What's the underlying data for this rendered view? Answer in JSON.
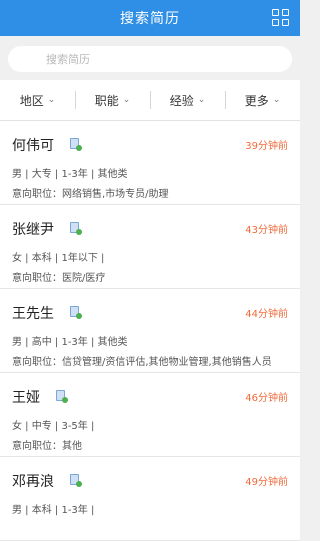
{
  "header": {
    "title": "搜索简历",
    "menu_icon": "grid-icon"
  },
  "search": {
    "placeholder": "搜索简历"
  },
  "filters": [
    {
      "label": "地区"
    },
    {
      "label": "职能"
    },
    {
      "label": "经验"
    },
    {
      "label": "更多"
    }
  ],
  "resumes": [
    {
      "name": "何伟可",
      "time": "39分钟前",
      "meta": "男 | 大专 | 1-3年 | 其他类",
      "job": "意向职位：网络销售,市场专员/助理"
    },
    {
      "name": "张继尹",
      "time": "43分钟前",
      "meta": "女 | 本科 | 1年以下 |",
      "job": "意向职位：医院/医疗"
    },
    {
      "name": "王先生",
      "time": "44分钟前",
      "meta": "男 | 高中 | 1-3年 | 其他类",
      "job": "意向职位：信贷管理/资信评估,其他物业管理,其他销售人员"
    },
    {
      "name": "王娅",
      "time": "46分钟前",
      "meta": "女 | 中专 | 3-5年 |",
      "job": "意向职位：其他"
    },
    {
      "name": "邓再浪",
      "time": "49分钟前",
      "meta": "男 | 本科 | 1-3年 |",
      "job": ""
    }
  ]
}
